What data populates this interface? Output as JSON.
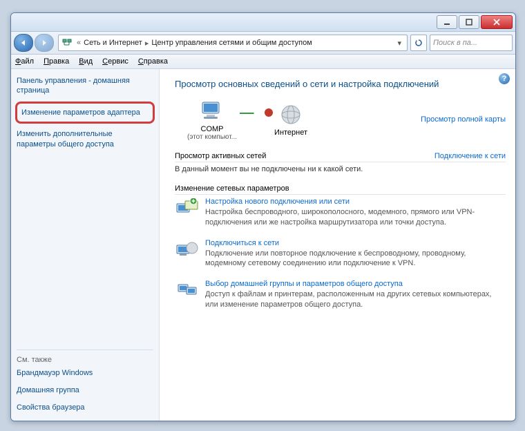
{
  "breadcrumb": [
    "Сеть и Интернет",
    "Центр управления сетями и общим доступом"
  ],
  "search": {
    "placeholder": "Поиск в па..."
  },
  "menu": {
    "file": "айл",
    "edit": "равка",
    "view": "ид",
    "tools": "ервис",
    "help": "правка"
  },
  "sidebar": {
    "home": "Панель управления - домашняя страница",
    "adapter": "Изменение параметров адаптера",
    "sharing": "Изменить дополнительные параметры общего доступа",
    "also": "См. также",
    "firewall": "Брандмауэр Windows",
    "homegroup": "Домашняя группа",
    "browser": "Свойства браузера"
  },
  "main": {
    "title": "Просмотр основных сведений о сети и настройка подключений",
    "map": {
      "comp": "COMP",
      "compsub": "(этот компьют...",
      "internet": "Интернет",
      "fullmap": "Просмотр полной карты"
    },
    "active": {
      "title": "Просмотр активных сетей",
      "connect": "Подключение к сети",
      "none": "В данный момент вы не подключены ни к какой сети."
    },
    "change": {
      "title": "Изменение сетевых параметров"
    },
    "opts": [
      {
        "title": "Настройка нового подключения или сети",
        "desc": "Настройка беспроводного, широкополосного, модемного, прямого или VPN-подключения или же настройка маршрутизатора или точки доступа."
      },
      {
        "title": "Подключиться к сети",
        "desc": "Подключение или повторное подключение к беспроводному, проводному, модемному сетевому соединению или подключение к VPN."
      },
      {
        "title": "Выбор домашней группы и параметров общего доступа",
        "desc": "Доступ к файлам и принтерам, расположенным на других сетевых компьютерах, или изменение параметров общего доступа."
      }
    ]
  }
}
